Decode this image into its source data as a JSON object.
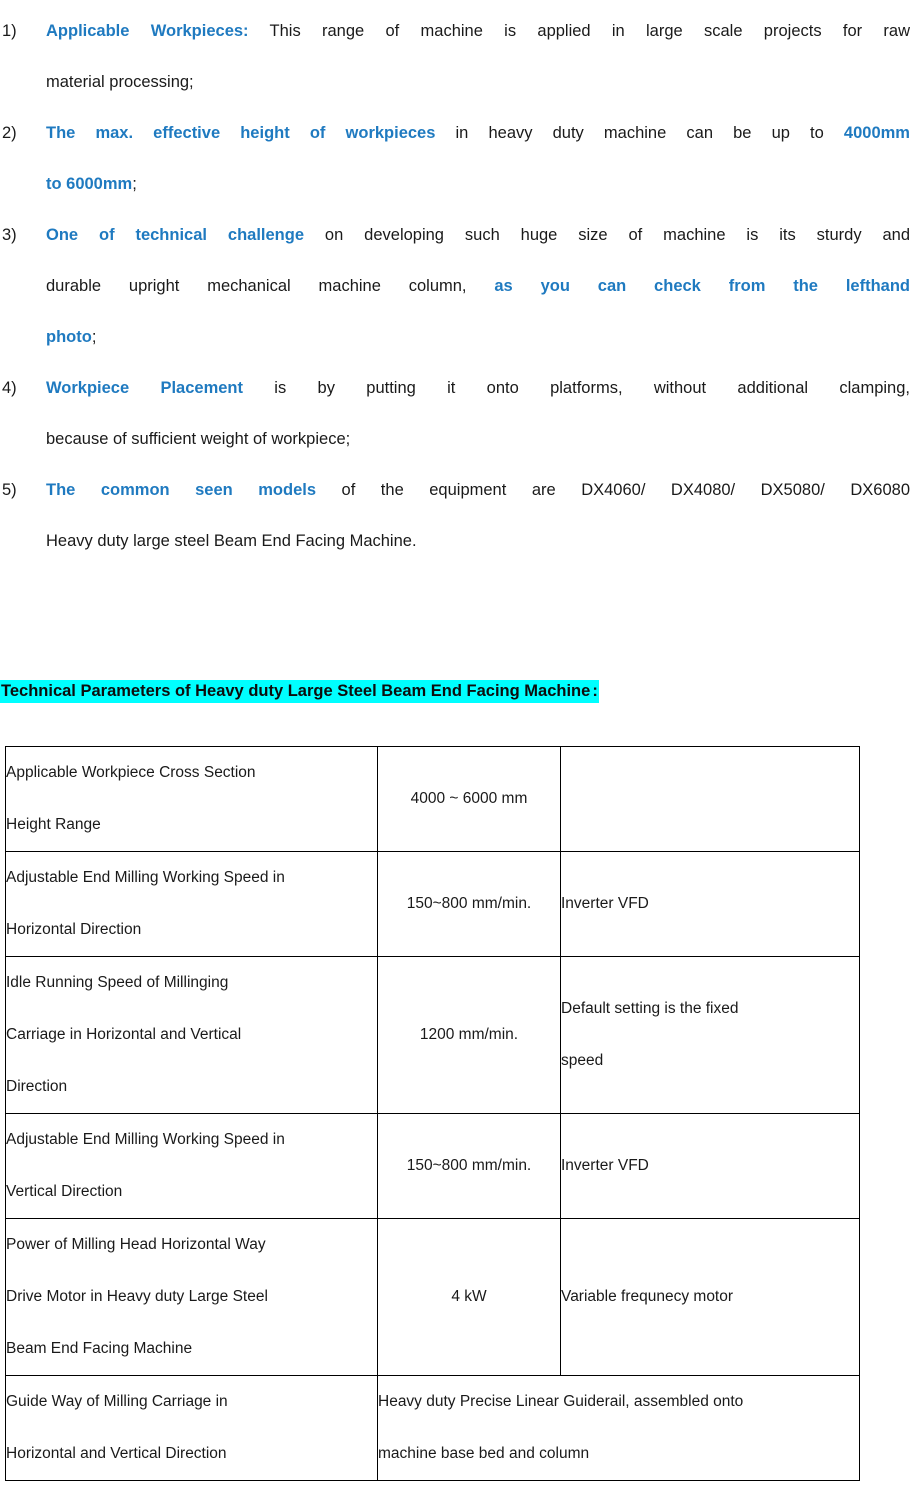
{
  "features": [
    {
      "marker": "1)",
      "lead": "Applicable Workpieces:",
      "line1_rest": " This range of machine is applied in large scale projects for raw",
      "line2": "material processing;"
    },
    {
      "marker": "2)",
      "lead": "The max. effective height of workpieces",
      "line1_rest": " in heavy duty machine can be up to ",
      "line1_tail": "4000mm",
      "line2_hl": "to 6000mm",
      "line2_rest": ";"
    },
    {
      "marker": "3)",
      "lead": "One of technical challenge",
      "line1_rest": " on developing such huge size of machine is its sturdy and",
      "line2_plain": "durable upright mechanical machine column, ",
      "line2_hl": "as you can check from the lefthand",
      "line3_hl": "photo",
      "line3_rest": ";"
    },
    {
      "marker": "4)",
      "lead": "Workpiece Placement",
      "line1_rest": " is by putting it onto platforms, without additional clamping,",
      "line2": "because of sufficient weight of workpiece;"
    },
    {
      "marker": "5)",
      "lead": "The common seen models",
      "line1_rest": " of the equipment are DX4060/ DX4080/ DX5080/ DX6080",
      "line2": "Heavy duty large steel Beam End Facing Machine."
    }
  ],
  "section_heading": {
    "text": "Technical Parameters of Heavy duty Large Steel Beam End Facing Machine",
    "suffix": ":"
  },
  "spec_table": {
    "rows": [
      {
        "param_lines": [
          "Applicable Workpiece Cross Section",
          "Height Range"
        ],
        "value": "4000 ~ 6000 mm",
        "note_lines": [
          ""
        ]
      },
      {
        "param_lines": [
          "Adjustable End Milling Working Speed in",
          "Horizontal Direction"
        ],
        "value": "150~800 mm/min.",
        "note_lines": [
          "Inverter VFD"
        ]
      },
      {
        "param_lines": [
          "Idle Running Speed of Millinging",
          "Carriage in Horizontal and Vertical",
          "Direction"
        ],
        "value": "1200 mm/min.",
        "note_lines": [
          "Default setting is the fixed",
          "speed"
        ]
      },
      {
        "param_lines": [
          "Adjustable End Milling Working Speed in",
          "Vertical Direction"
        ],
        "value": "150~800 mm/min.",
        "note_lines": [
          "Inverter VFD"
        ]
      },
      {
        "param_lines": [
          "Power of Milling Head Horizontal Way",
          "Drive Motor in Heavy duty Large Steel",
          "Beam End Facing Machine"
        ],
        "value": "4 kW",
        "note_lines": [
          "Variable frequnecy motor"
        ]
      },
      {
        "param_lines": [
          "Guide Way of Milling Carriage in",
          "Horizontal and Vertical Direction"
        ],
        "merged_lines": [
          "  Heavy duty Precise Linear Guiderail, assembled onto",
          "machine base bed and column"
        ]
      }
    ]
  },
  "colors": {
    "accent_blue": "#1f7ac0",
    "highlight_cyan": "#00ffff",
    "text_black": "#1a1a1a",
    "table_border": "#000000"
  }
}
